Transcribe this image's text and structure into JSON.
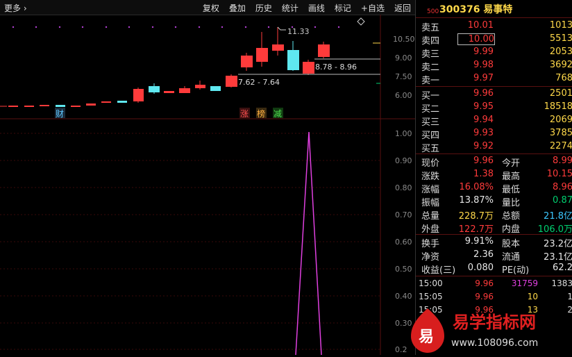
{
  "toolbar": {
    "more_label": "更多",
    "more_icon": "chevron-right-icon",
    "items": [
      "复权",
      "叠加",
      "历史",
      "统计",
      "画线",
      "标记",
      "+自选",
      "返回"
    ]
  },
  "kline": {
    "ticks": [
      "10.50",
      "9.00",
      "7.50",
      "6.00"
    ],
    "peak_label": "11.33",
    "range_top": "8.78 - 8.96",
    "range_bottom": "7.62 - 7.64",
    "markers": {
      "cai": "财",
      "zhang": "涨",
      "bang": "榜",
      "jian": "减"
    }
  },
  "indicator": {
    "ticks": [
      "1.00",
      "0.90",
      "0.80",
      "0.70",
      "0.60",
      "0.50",
      "0.40",
      "0.30",
      "0.2"
    ]
  },
  "colors": {
    "up": "#ff3b3b",
    "down": "#5fe8f0",
    "indicator": "#e040e0",
    "axis": "#5a0f0f",
    "label": "#ffd94a"
  },
  "stock": {
    "prefix": "500",
    "code": "300376",
    "name": "易事特"
  },
  "order_book": {
    "asks": [
      {
        "label": "卖五",
        "price": "10.01",
        "volume": "1013"
      },
      {
        "label": "卖四",
        "price": "10.00",
        "volume": "5513"
      },
      {
        "label": "卖三",
        "price": "9.99",
        "volume": "2053"
      },
      {
        "label": "卖二",
        "price": "9.98",
        "volume": "3692"
      },
      {
        "label": "卖一",
        "price": "9.97",
        "volume": "768"
      }
    ],
    "bids": [
      {
        "label": "买一",
        "price": "9.96",
        "volume": "2501"
      },
      {
        "label": "买二",
        "price": "9.95",
        "volume": "18518"
      },
      {
        "label": "买三",
        "price": "9.94",
        "volume": "2069"
      },
      {
        "label": "买四",
        "price": "9.93",
        "volume": "3785"
      },
      {
        "label": "买五",
        "price": "9.92",
        "volume": "2274"
      }
    ]
  },
  "quote": {
    "rows": [
      {
        "l1": "现价",
        "v1": "9.96",
        "l2": "今开",
        "v2": "8.99"
      },
      {
        "l1": "涨跌",
        "v1": "1.38",
        "l2": "最高",
        "v2": "10.15"
      },
      {
        "l1": "涨幅",
        "v1": "16.08%",
        "l2": "最低",
        "v2": "8.96"
      },
      {
        "l1": "振幅",
        "v1": "13.87%",
        "l2": "量比",
        "v2": "0.87"
      },
      {
        "l1": "总量",
        "v1": "228.7万",
        "l2": "总额",
        "v2": "21.8亿"
      },
      {
        "l1": "外盘",
        "v1": "122.7万",
        "l2": "内盘",
        "v2": "106.0万"
      },
      {
        "l1": "换手",
        "v1": "9.91%",
        "l2": "股本",
        "v2": "23.2亿"
      },
      {
        "l1": "净资",
        "v1": "2.36",
        "l2": "流通",
        "v2": "23.1亿"
      },
      {
        "l1": "收益(三)",
        "v1": "0.080",
        "l2": "PE(动)",
        "v2": "62.2"
      }
    ]
  },
  "ticks": [
    {
      "time": "15:00",
      "price": "9.96",
      "volume": "31759",
      "num": "1383"
    },
    {
      "time": "15:05",
      "price": "9.96",
      "volume": "10",
      "num": "1"
    },
    {
      "time": "15:05",
      "price": "9.96",
      "volume": "13",
      "num": "2"
    }
  ],
  "watermark": {
    "logo_char": "易",
    "title": "易学指标网",
    "url": "www.108096.com"
  }
}
